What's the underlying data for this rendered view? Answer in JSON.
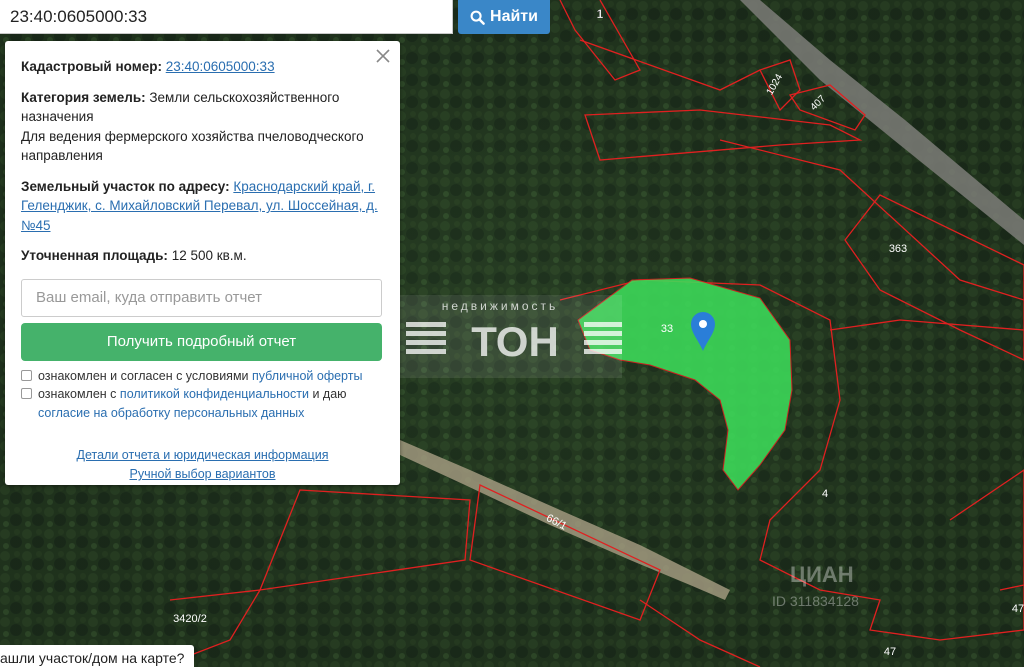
{
  "search": {
    "value": "23:40:0605000:33",
    "button_label": "Найти"
  },
  "panel": {
    "cadastral_label": "Кадастровый номер:",
    "cadastral_value": "23:40:0605000:33",
    "category_label": "Категория земель:",
    "category_value": "Земли сельскохозяйственного назначения",
    "usage_value": "Для ведения фермерского хозяйства пчеловодческого направления",
    "address_label": "Земельный участок по адресу:",
    "address_value": "Краснодарский край, г. Геленджик, с. Михайловский Перевал, ул. Шоссейная, д. №45",
    "area_label": "Уточненная площадь:",
    "area_value": "12 500 кв.м.",
    "email_placeholder": "Ваш email, куда отправить отчет",
    "report_button": "Получить подробный отчет",
    "consent1_prefix": "ознакомлен и согласен с условиями",
    "consent1_link": "публичной оферты",
    "consent2_prefix": "ознакомлен с",
    "consent2_link": "политикой конфиденциальности",
    "consent2_mid": "и даю",
    "consent2_link2": "согласие на обработку персональных данных",
    "details_link": "Детали отчета и юридическая информация",
    "manual_link": "Ручной выбор вариантов"
  },
  "map": {
    "plot_labels": [
      "1",
      "1024",
      "407",
      "363",
      "33",
      "4",
      "66/1",
      "3420/2",
      "47",
      "47"
    ],
    "watermark_small": "недвижимость",
    "watermark_big": "ТОН",
    "watermark_cian": "ЦИАН",
    "watermark_id": "ID 311834128",
    "selected_color": "#3ddc5a",
    "boundary_color": "#e02020"
  },
  "help": {
    "text": "ашли участок/дом на карте?"
  }
}
